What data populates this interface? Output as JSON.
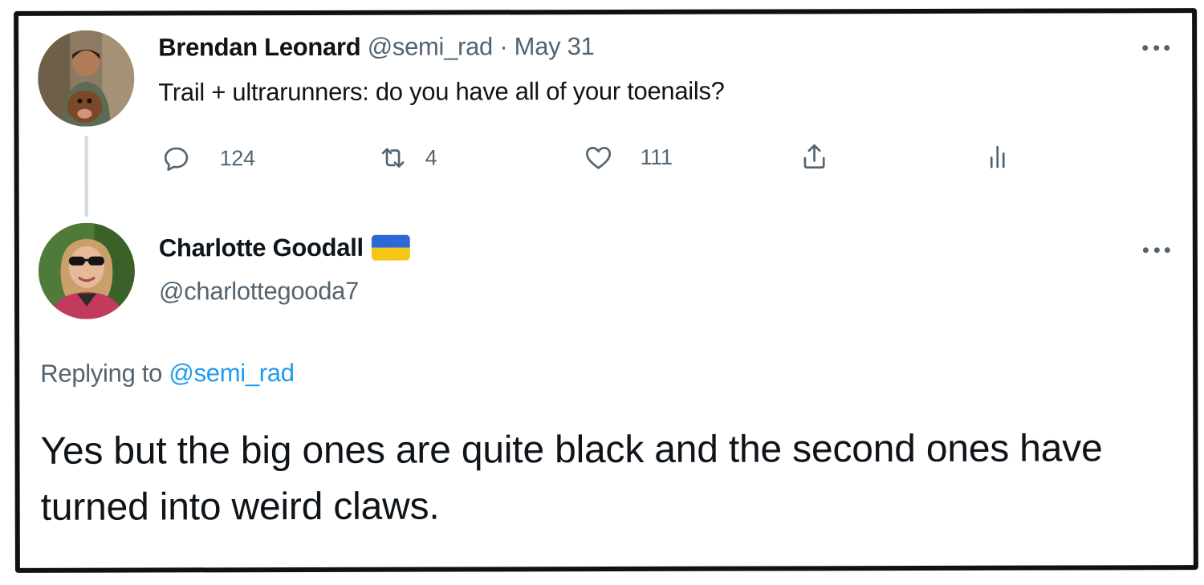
{
  "tweets": [
    {
      "author_name": "Brendan Leonard",
      "handle": "@semi_rad",
      "separator": "·",
      "date": "May 31",
      "text": "Trail + ultrarunners: do you have all of your toenails?",
      "stats": {
        "replies": "124",
        "retweets": "4",
        "likes": "111"
      },
      "icons": [
        "reply-icon",
        "retweet-icon",
        "like-icon",
        "share-icon",
        "analytics-icon",
        "more-icon"
      ]
    },
    {
      "author_name": "Charlotte Goodall",
      "handle": "@charlottegooda7",
      "flag": {
        "top_color": "#2e68d6",
        "bottom_color": "#f5c518"
      },
      "replying_prefix": "Replying to",
      "replying_to": "@semi_rad",
      "text": "Yes but the big ones are quite black and the second ones have turned into weird claws."
    }
  ],
  "colors": {
    "text": "#0f1419",
    "muted": "#536471",
    "link": "#1d9bf0",
    "thread_line": "#cfd9de"
  }
}
